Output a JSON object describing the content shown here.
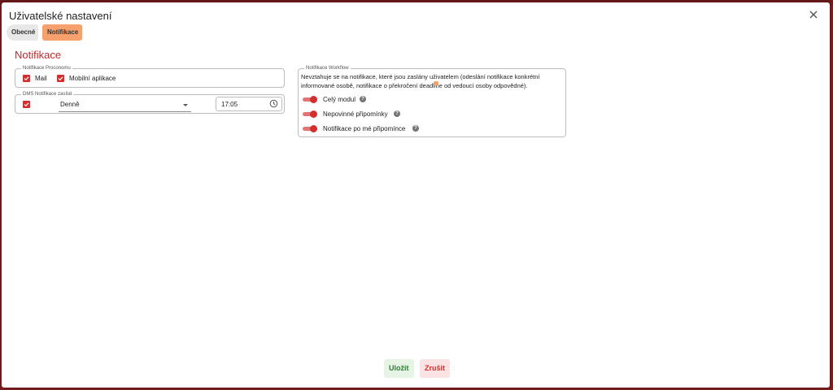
{
  "dialog": {
    "title": "Uživatelské nastavení",
    "close_icon": "close-icon"
  },
  "tabs": [
    {
      "label": "Obecné",
      "active": false
    },
    {
      "label": "Notifikace",
      "active": true
    }
  ],
  "section": {
    "title": "Notifikace"
  },
  "proconom": {
    "legend": "Notifikace Proconomu",
    "options": [
      {
        "label": "Mail",
        "checked": true
      },
      {
        "label": "Mobilní aplikace",
        "checked": true
      }
    ]
  },
  "dms": {
    "legend": "DMS Notifikace zasílat",
    "checked": true,
    "frequency": "Denně",
    "time": "17:05"
  },
  "workflow": {
    "legend": "Notifikace Workflow",
    "description": "Nevztahuje se na notifikace, které jsou zaslány uživatelem (odeslání notifikace konkrétní informované osobě, notifikace o překročení deadline od vedoucí osoby odpovědné).",
    "toggles": [
      {
        "label": "Celý modul",
        "on": true
      },
      {
        "label": "Nepovinné připomínky",
        "on": true
      },
      {
        "label": "Notifikace po mé připomínce",
        "on": true
      }
    ],
    "help_glyph": "?"
  },
  "actions": {
    "save": "Uložit",
    "cancel": "Zrušit"
  },
  "colors": {
    "accent": "#d32f2f",
    "tab_active": "#f6a06e",
    "save": "#2e7d32"
  }
}
